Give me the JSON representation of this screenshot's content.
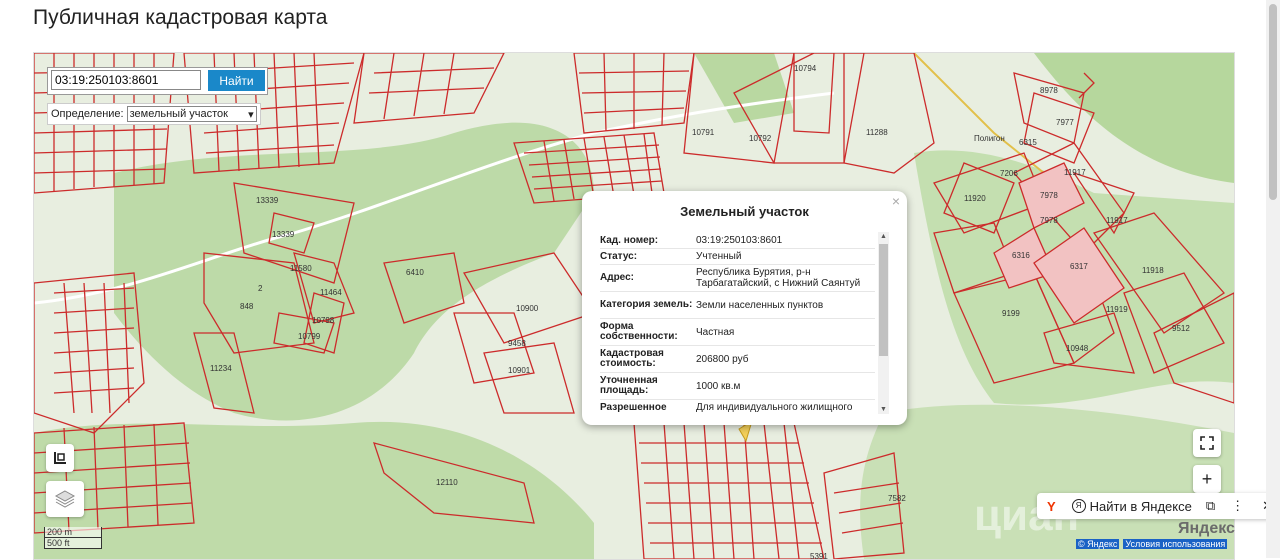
{
  "page": {
    "title": "Публичная кадастровая карта"
  },
  "search": {
    "value": "03:19:250103:8601",
    "button_label": "Найти"
  },
  "definition": {
    "label": "Определение:",
    "selected": "земельный участок"
  },
  "popup": {
    "title": "Земельный участок",
    "close": "×",
    "rows": [
      {
        "key": "Кад. номер:",
        "value": "03:19:250103:8601"
      },
      {
        "key": "Статус:",
        "value": "Учтенный"
      },
      {
        "key": "Адрес:",
        "value": "Республика Бурятия, р-н Тарбагатайский, с Нижний Саянтуй"
      },
      {
        "key": "Категория земель:",
        "value": "Земли населенных пунктов"
      },
      {
        "key": "Форма собственности:",
        "value": "Частная"
      },
      {
        "key": "Кадастровая стоимость:",
        "value": "206800 руб"
      },
      {
        "key": "Уточненная площадь:",
        "value": "1000 кв.м"
      },
      {
        "key": "Разрешенное использование:",
        "value": "Для индивидуального жилищного строительства"
      }
    ]
  },
  "map_labels": [
    "10794",
    "10791",
    "10792",
    "11288",
    "8978",
    "7977",
    "Полигон",
    "6315",
    "7206",
    "11917",
    "7978",
    "11920",
    "7978",
    "11917",
    "6316",
    "6317",
    "11918",
    "9199",
    "11919",
    "9512",
    "10948",
    "13339",
    "13339",
    "11580",
    "2",
    "11464",
    "848",
    "10798",
    "10799",
    "11234",
    "6410",
    "10900",
    "9458",
    "10901",
    "12110",
    "7582",
    "5391"
  ],
  "yandex_bar": {
    "find_label": "Найти в Яндексе"
  },
  "wordmark": "Яндекс",
  "copyright": {
    "left": "© Яндекс",
    "terms": "Условия использования"
  },
  "scale": {
    "metric": "200 m",
    "imperial": "500 ft"
  },
  "watermark": "циан",
  "controls": {
    "zoom_in": "+"
  },
  "colors": {
    "parcel_outline": "#cc2b2b",
    "selected_parcel_fill": "#f2c2c2",
    "forest": "#b9d8a4",
    "search_button": "#1a88c9"
  }
}
